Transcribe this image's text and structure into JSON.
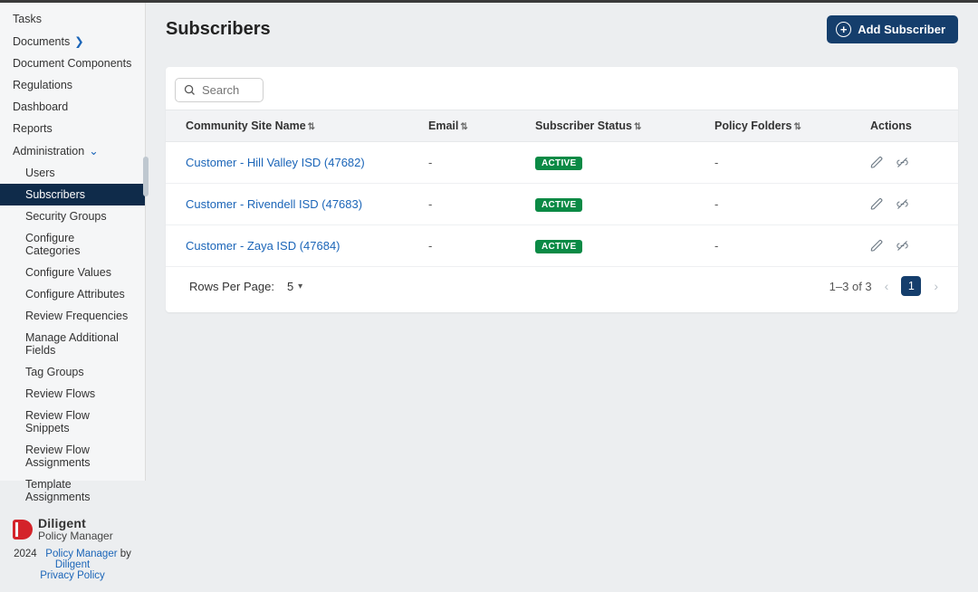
{
  "sidebar": {
    "top_items": [
      {
        "label": "Tasks"
      },
      {
        "label": "Documents",
        "chevron": true
      },
      {
        "label": "Document Components"
      },
      {
        "label": "Regulations"
      },
      {
        "label": "Dashboard"
      },
      {
        "label": "Reports"
      },
      {
        "label": "Administration",
        "expanded": true
      }
    ],
    "admin_items": [
      {
        "label": "Users"
      },
      {
        "label": "Subscribers",
        "active": true
      },
      {
        "label": "Security Groups"
      },
      {
        "label": "Configure Categories"
      },
      {
        "label": "Configure Values"
      },
      {
        "label": "Configure Attributes"
      },
      {
        "label": "Review Frequencies"
      },
      {
        "label": "Manage Additional Fields"
      },
      {
        "label": "Tag Groups"
      },
      {
        "label": "Review Flows"
      },
      {
        "label": "Review Flow Snippets"
      },
      {
        "label": "Review Flow Assignments"
      },
      {
        "label": "Template Assignments"
      }
    ],
    "brand": {
      "line1": "Diligent",
      "line2": "Policy Manager"
    },
    "footer": {
      "year": "2024",
      "product_link": "Policy Manager",
      "by": " by ",
      "company_link": "Diligent",
      "privacy": "Privacy Policy"
    }
  },
  "page": {
    "title": "Subscribers",
    "add_button": "Add Subscriber",
    "search_placeholder": "Search"
  },
  "table": {
    "columns": {
      "name": "Community Site Name",
      "email": "Email",
      "status": "Subscriber Status",
      "folders": "Policy Folders",
      "actions": "Actions"
    },
    "rows": [
      {
        "name": "Customer - Hill Valley ISD (47682)",
        "email": "-",
        "status": "ACTIVE",
        "folders": "-"
      },
      {
        "name": "Customer - Rivendell ISD (47683)",
        "email": "-",
        "status": "ACTIVE",
        "folders": "-"
      },
      {
        "name": "Customer - Zaya ISD (47684)",
        "email": "-",
        "status": "ACTIVE",
        "folders": "-"
      }
    ],
    "footer": {
      "rows_per_page_label": "Rows Per Page:",
      "rows_per_page_value": "5",
      "range": "1–3 of 3",
      "current_page": "1"
    }
  }
}
